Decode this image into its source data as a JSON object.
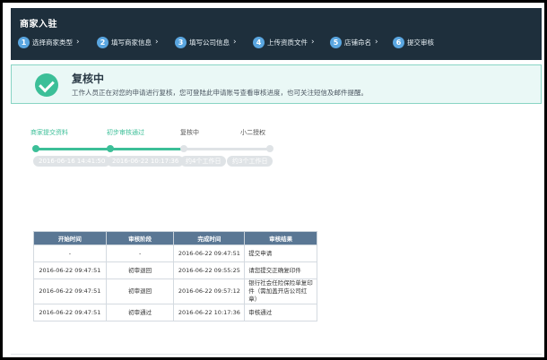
{
  "header": {
    "title": "商家入驻",
    "steps": [
      {
        "num": "1",
        "label": "选择商家类型"
      },
      {
        "num": "2",
        "label": "填写商家信息"
      },
      {
        "num": "3",
        "label": "填写公司信息"
      },
      {
        "num": "4",
        "label": "上传资质文件"
      },
      {
        "num": "5",
        "label": "店铺命名"
      },
      {
        "num": "6",
        "label": "提交审核"
      }
    ],
    "chevron": "›"
  },
  "banner": {
    "title": "复核中",
    "description": "工作人员正在对您的申请进行复核，您可登陆此申请账号查看审核进度，也可关注短信及邮件提醒。"
  },
  "progress": {
    "active_color": "#3cbf98",
    "inactive_color": "#dfe3e6",
    "stages": [
      {
        "label": "商家提交资料",
        "badge": "2016-06-16 14:41:50"
      },
      {
        "label": "初步审核通过",
        "badge": "2016-06-22 10:17:36"
      },
      {
        "label": "复核中",
        "badge": "约4个工作日"
      },
      {
        "label": "小二授权",
        "badge": "约3个工作日"
      }
    ]
  },
  "table": {
    "headers": [
      "开始时间",
      "审核阶段",
      "完成时间",
      "审核结果"
    ],
    "rows": [
      [
        "-",
        "-",
        "2016-06-22 09:47:51",
        "提交申请"
      ],
      [
        "2016-06-22 09:47:51",
        "初审退回",
        "2016-06-22 09:55:25",
        "请您提交正确复印件"
      ],
      [
        "2016-06-22 09:47:51",
        "初审退回",
        "2016-06-22 09:57:12",
        "银行社会任险保险单复印件（需加盖开店公司红章）"
      ],
      [
        "2016-06-22 09:47:51",
        "初审通过",
        "2016-06-22 10:17:36",
        "审核通过"
      ]
    ]
  }
}
